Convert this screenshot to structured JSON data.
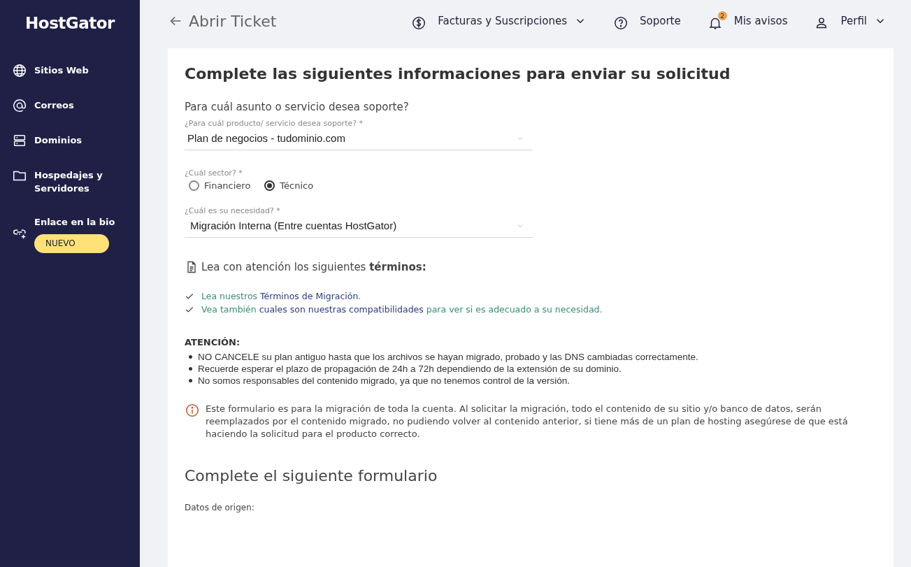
{
  "sidebar": {
    "logo": "HostGator",
    "items": [
      {
        "label": "Sitios Web"
      },
      {
        "label": "Correos"
      },
      {
        "label": "Dominios"
      },
      {
        "label": "Hospedajes y Servidores"
      },
      {
        "label": "Enlace en la bio",
        "badge": "NUEVO"
      }
    ]
  },
  "header": {
    "back_title": "Abrir Ticket",
    "menu": [
      {
        "label": "Facturas y Suscripciones",
        "dropdown": true
      },
      {
        "label": "Soporte",
        "dropdown": false
      },
      {
        "label": "Mis avisos",
        "dropdown": false,
        "count": "2"
      },
      {
        "label": "Perfil",
        "dropdown": true
      }
    ]
  },
  "form": {
    "title": "Complete las siguientes informaciones para enviar su solicitud",
    "question": "Para cuál asunto o servicio desea soporte?",
    "product": {
      "label": "¿Para cuál producto/ servicio desea soporte? *",
      "value": "Plan de negocios - tudominio.com"
    },
    "sector": {
      "label": "¿Cuál sector? *",
      "options": [
        {
          "label": "Financiero",
          "selected": false
        },
        {
          "label": "Técnico",
          "selected": true
        }
      ]
    },
    "need": {
      "label": "¿Cuál es su necesidad? *",
      "value": "Migración Interna (Entre cuentas HostGator)"
    },
    "terms_heading": "Lea con atención los siguientes **términos:**",
    "checklist": [
      [
        {
          "kind": "plain",
          "text": "Lea nuestros "
        },
        {
          "kind": "link",
          "text": "Términos de Migración"
        },
        {
          "kind": "plain",
          "text": "."
        }
      ],
      [
        {
          "kind": "plain",
          "text": "Vea también "
        },
        {
          "kind": "link",
          "text": "cuales son nuestras compatibilidades"
        },
        {
          "kind": "plain",
          "text": " para ver si es adecuado a su necesidad."
        }
      ]
    ],
    "attention_title": "ATENCIÓN:",
    "attention_items": [
      "NO CANCELE su plan antiguo hasta que los archivos se hayan migrado, probado y las DNS cambiadas correctamente.",
      "Recuerde esperar el plazo de propagación de 24h a 72h dependiendo de la extensión de su dominio.",
      "No somos responsables del contenido migrado, ya que no tenemos control de la versión."
    ],
    "info_notice": "Este formulario es para la migración de toda la cuenta. Al solicitar la migración, todo el contenido de su sitio y/o banco de datos, serán reemplazados por el contenido migrado, no pudiendo volver al contenido anterior, si tiene más de un plan de hosting asegúrese de que está haciendo la solicitud para el producto correcto.",
    "section_title": "Complete el siguiente formulario",
    "origin_label": "Datos de origen:"
  }
}
